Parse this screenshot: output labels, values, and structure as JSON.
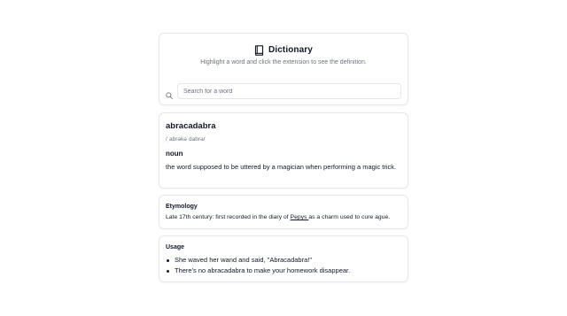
{
  "header": {
    "title": "Dictionary",
    "subtitle": "Highlight a word and click the extension to see the definition.",
    "icon": "book-icon"
  },
  "search": {
    "placeholder": "Search for a word",
    "value": "",
    "icon": "search-icon"
  },
  "entry": {
    "word": "abracadabra",
    "phonetic": "/ˌabrəkəˈdabrə/",
    "part_of_speech": "noun",
    "definition": "the word supposed to be uttered by a magician when performing a magic trick."
  },
  "etymology": {
    "title": "Etymology",
    "text_before": "Late 17th century: first recorded in the diary of ",
    "link": "Pepys ",
    "text_after": "as a charm used to cure ague."
  },
  "usage": {
    "title": "Usage",
    "examples": [
      "She waved her wand and said, \"Abracadabra!\"",
      "There's no abracadabra to make your homework disappear."
    ]
  },
  "colors": {
    "text": "#111827",
    "muted": "#6b7280",
    "border": "#e5e7eb",
    "background": "#ffffff"
  }
}
